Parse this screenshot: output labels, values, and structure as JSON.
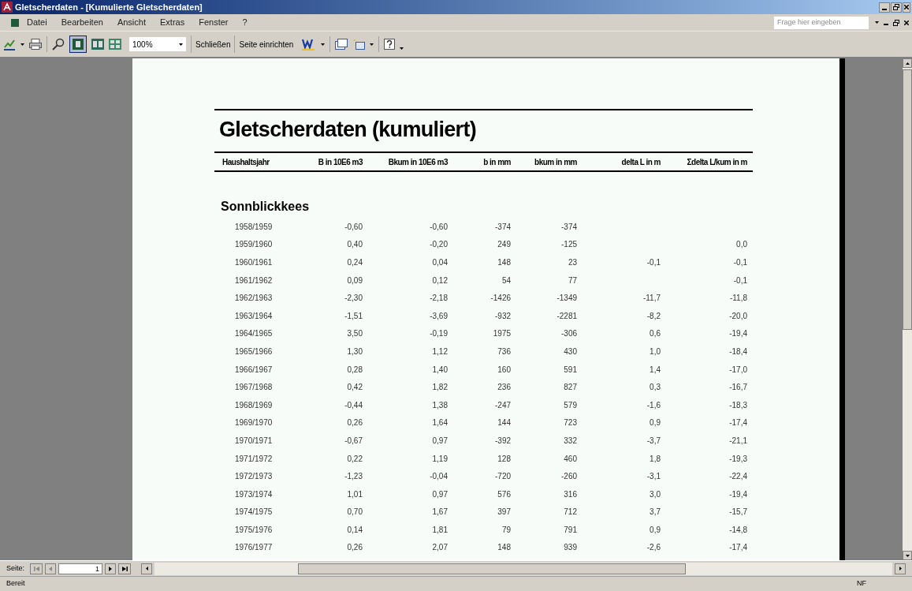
{
  "window": {
    "title": "Gletscherdaten - [Kumulierte Gletscherdaten]"
  },
  "menu": [
    "Datei",
    "Bearbeiten",
    "Ansicht",
    "Extras",
    "Fenster",
    "?"
  ],
  "help_field": {
    "placeholder": "Frage hier eingeben"
  },
  "toolbar": {
    "zoom": "100%",
    "buttons": [
      "Schließen",
      "Seite einrichten"
    ]
  },
  "report": {
    "title": "Gletscherdaten (kumuliert)",
    "columns": [
      "Haushaltsjahr",
      "B in 10E6 m3",
      "Bkum in 10E6 m3",
      "b in mm",
      "bkum in mm",
      "delta L in m",
      "Σdelta L/kum in m"
    ],
    "section": "Sonnblickkees",
    "rows": [
      [
        "1958/1959",
        "-0,60",
        "-0,60",
        "-374",
        "-374",
        null,
        null
      ],
      [
        "1959/1960",
        "0,40",
        "-0,20",
        "249",
        "-125",
        null,
        "0,0"
      ],
      [
        "1960/1961",
        "0,24",
        "0,04",
        "148",
        "23",
        "-0,1",
        "-0,1"
      ],
      [
        "1961/1962",
        "0,09",
        "0,12",
        "54",
        "77",
        null,
        "-0,1"
      ],
      [
        "1962/1963",
        "-2,30",
        "-2,18",
        "-1426",
        "-1349",
        "-11,7",
        "-11,8"
      ],
      [
        "1963/1964",
        "-1,51",
        "-3,69",
        "-932",
        "-2281",
        "-8,2",
        "-20,0"
      ],
      [
        "1964/1965",
        "3,50",
        "-0,19",
        "1975",
        "-306",
        "0,6",
        "-19,4"
      ],
      [
        "1965/1966",
        "1,30",
        "1,12",
        "736",
        "430",
        "1,0",
        "-18,4"
      ],
      [
        "1966/1967",
        "0,28",
        "1,40",
        "160",
        "591",
        "1,4",
        "-17,0"
      ],
      [
        "1967/1968",
        "0,42",
        "1,82",
        "236",
        "827",
        "0,3",
        "-16,7"
      ],
      [
        "1968/1969",
        "-0,44",
        "1,38",
        "-247",
        "579",
        "-1,6",
        "-18,3"
      ],
      [
        "1969/1970",
        "0,26",
        "1,64",
        "144",
        "723",
        "0,9",
        "-17,4"
      ],
      [
        "1970/1971",
        "-0,67",
        "0,97",
        "-392",
        "332",
        "-3,7",
        "-21,1"
      ],
      [
        "1971/1972",
        "0,22",
        "1,19",
        "128",
        "460",
        "1,8",
        "-19,3"
      ],
      [
        "1972/1973",
        "-1,23",
        "-0,04",
        "-720",
        "-260",
        "-3,1",
        "-22,4"
      ],
      [
        "1973/1974",
        "1,01",
        "0,97",
        "576",
        "316",
        "3,0",
        "-19,4"
      ],
      [
        "1974/1975",
        "0,70",
        "1,67",
        "397",
        "712",
        "3,7",
        "-15,7"
      ],
      [
        "1975/1976",
        "0,14",
        "1,81",
        "79",
        "791",
        "0,9",
        "-14,8"
      ],
      [
        "1976/1977",
        "0,26",
        "2,07",
        "148",
        "939",
        "-2,6",
        "-17,4"
      ]
    ]
  },
  "pager": {
    "label": "Seite:",
    "page": "1"
  },
  "status_bar": {
    "text": "Bereit",
    "indicator": "NF"
  }
}
